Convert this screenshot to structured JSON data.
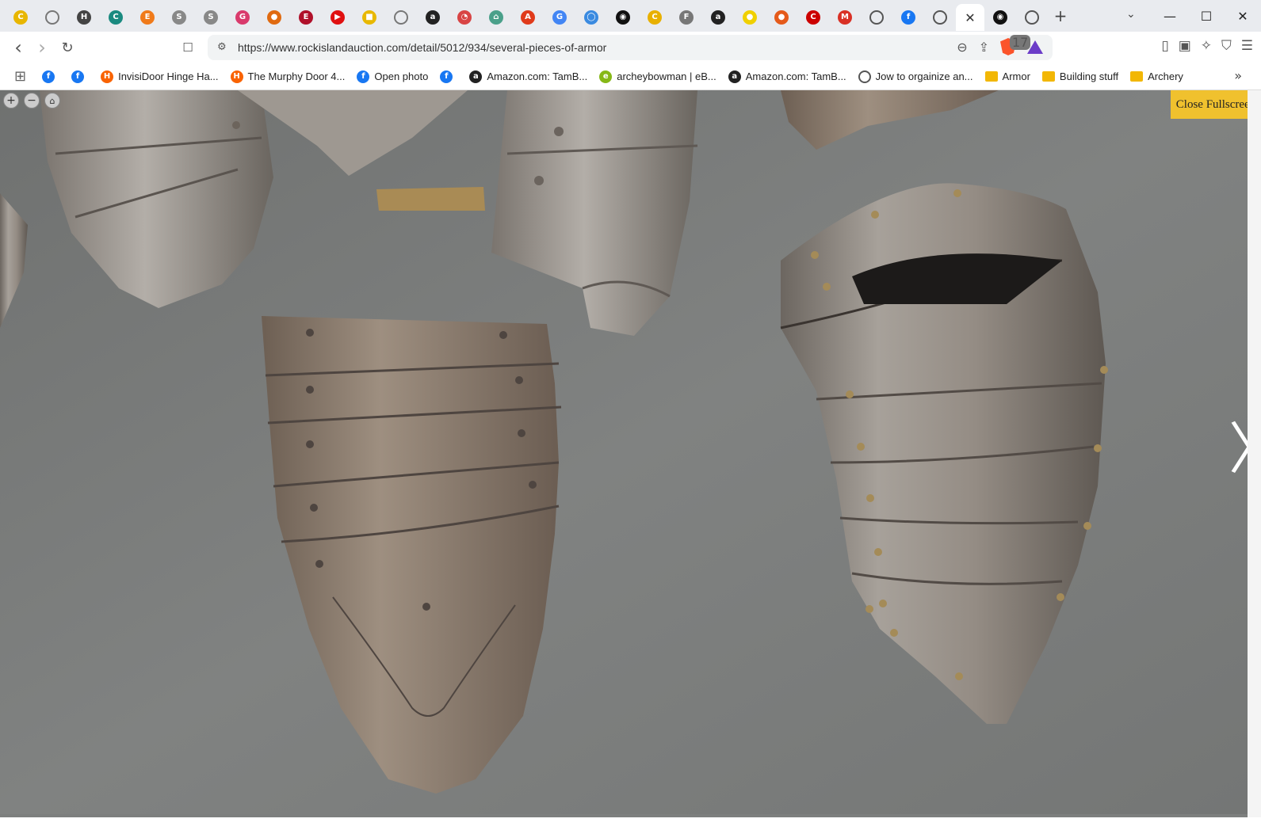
{
  "tabs": {
    "items": [
      {
        "icon": "chrome-favicon-icon",
        "color": "#e8b600",
        "glyph": "C"
      },
      {
        "icon": "globe-icon",
        "color": "#777777",
        "glyph": ""
      },
      {
        "icon": "h-favicon-icon",
        "color": "#444444",
        "glyph": "H"
      },
      {
        "icon": "c-favicon-icon",
        "color": "#1a8a80",
        "glyph": "C"
      },
      {
        "icon": "e-favicon-icon",
        "color": "#f07a1a",
        "glyph": "E"
      },
      {
        "icon": "s-favicon-icon",
        "color": "#888888",
        "glyph": "S"
      },
      {
        "icon": "s-favicon-icon",
        "color": "#888888",
        "glyph": "S"
      },
      {
        "icon": "g-favicon-icon",
        "color": "#d93a6c",
        "glyph": "G"
      },
      {
        "icon": "orange-favicon-icon",
        "color": "#e06a10",
        "glyph": "●"
      },
      {
        "icon": "red-favicon-icon",
        "color": "#b0102a",
        "glyph": "E"
      },
      {
        "icon": "youtube-icon",
        "color": "#e01010",
        "glyph": "▶"
      },
      {
        "icon": "yellow-favicon-icon",
        "color": "#e8b800",
        "glyph": "■"
      },
      {
        "icon": "globe-icon",
        "color": "#777777",
        "glyph": ""
      },
      {
        "icon": "amazon-icon",
        "color": "#222222",
        "glyph": "a"
      },
      {
        "icon": "gauge-icon",
        "color": "#d84444",
        "glyph": "◔"
      },
      {
        "icon": "home-icon",
        "color": "#4aa08a",
        "glyph": "⌂"
      },
      {
        "icon": "agr-favicon-icon",
        "color": "#e03a1a",
        "glyph": "A"
      },
      {
        "icon": "google-icon",
        "color": "#4285f4",
        "glyph": "G"
      },
      {
        "icon": "blue-circle-icon",
        "color": "#3a8ae0",
        "glyph": "◯"
      },
      {
        "icon": "eye-icon",
        "color": "#111111",
        "glyph": "◉"
      },
      {
        "icon": "c-yellow-favicon-icon",
        "color": "#e8b000",
        "glyph": "C"
      },
      {
        "icon": "ef-favicon-icon",
        "color": "#777777",
        "glyph": "F"
      },
      {
        "icon": "amazon-icon",
        "color": "#222222",
        "glyph": "a"
      },
      {
        "icon": "yellow-circle-icon",
        "color": "#f0d000",
        "glyph": "●"
      },
      {
        "icon": "orange-circle-icon",
        "color": "#e55a1a",
        "glyph": "●"
      },
      {
        "icon": "cnn-icon",
        "color": "#cc0000",
        "glyph": "C"
      },
      {
        "icon": "gmail-icon",
        "color": "#d93025",
        "glyph": "M"
      },
      {
        "icon": "globe-icon",
        "color": "#555555",
        "glyph": ""
      },
      {
        "icon": "facebook-icon",
        "color": "#1877f2",
        "glyph": "f"
      },
      {
        "icon": "globe-icon",
        "color": "#555555",
        "glyph": ""
      },
      {
        "icon": "close-icon",
        "color": "#333333",
        "glyph": "✕",
        "active": true
      },
      {
        "icon": "eye-icon",
        "color": "#111111",
        "glyph": "◉"
      },
      {
        "icon": "globe-icon",
        "color": "#555555",
        "glyph": ""
      }
    ],
    "new_tab_glyph": "+",
    "tab_list_glyph": "⌄"
  },
  "window_controls": {
    "minimize": "—",
    "maximize": "☐",
    "close": "✕"
  },
  "toolbar": {
    "back_glyph": "‹",
    "forward_glyph": "›",
    "reload_glyph": "↻",
    "bookmark_glyph": "🔖",
    "url": "https://www.rockislandauction.com/detail/5012/934/several-pieces-of-armor",
    "site_info_glyph": "⚙",
    "zoom_glyph": "⊖",
    "share_glyph": "⇪",
    "shields_count": "17",
    "sidebar_glyph": "▯",
    "wallet_glyph": "▣",
    "leo_glyph": "✧",
    "vpn_glyph": "⛉",
    "menu_glyph": "☰"
  },
  "bookmarks": {
    "apps_glyph": "⊞",
    "items": [
      {
        "label": "",
        "icon": "facebook-icon",
        "color": "#1877f2",
        "glyph": "f"
      },
      {
        "label": "",
        "icon": "facebook-icon",
        "color": "#1877f2",
        "glyph": "f"
      },
      {
        "label": "InvisiDoor Hinge Ha...",
        "icon": "home-depot-icon",
        "color": "#f96302",
        "glyph": "H"
      },
      {
        "label": "The Murphy Door 4...",
        "icon": "home-depot-icon",
        "color": "#f96302",
        "glyph": "H"
      },
      {
        "label": "Open photo",
        "icon": "facebook-icon",
        "color": "#1877f2",
        "glyph": "f"
      },
      {
        "label": "",
        "icon": "facebook-icon",
        "color": "#1877f2",
        "glyph": "f"
      },
      {
        "label": "Amazon.com: TamB...",
        "icon": "amazon-icon",
        "color": "#222222",
        "glyph": "a"
      },
      {
        "label": "archeybowman | eB...",
        "icon": "ebay-icon",
        "color": "#86b817",
        "glyph": "e"
      },
      {
        "label": "Amazon.com: TamB...",
        "icon": "amazon-icon",
        "color": "#222222",
        "glyph": "a"
      },
      {
        "label": "Jow to orgainize an...",
        "icon": "globe-icon",
        "color": "#555555",
        "glyph": ""
      },
      {
        "label": "Armor",
        "icon": "folder-icon",
        "color": "#f2b705",
        "glyph": ""
      },
      {
        "label": "Building stuff",
        "icon": "folder-icon",
        "color": "#f2b705",
        "glyph": ""
      },
      {
        "label": "Archery",
        "icon": "folder-icon",
        "color": "#f2b705",
        "glyph": ""
      }
    ],
    "more_glyph": "»"
  },
  "viewer": {
    "zoom_in_glyph": "+",
    "zoom_out_glyph": "−",
    "home_glyph": "⌂",
    "close_fullscreen_label": "Close Fullscreen",
    "next_glyph": "〉",
    "background_color": "#7d7f7e",
    "accent_color": "#f0c12e"
  }
}
